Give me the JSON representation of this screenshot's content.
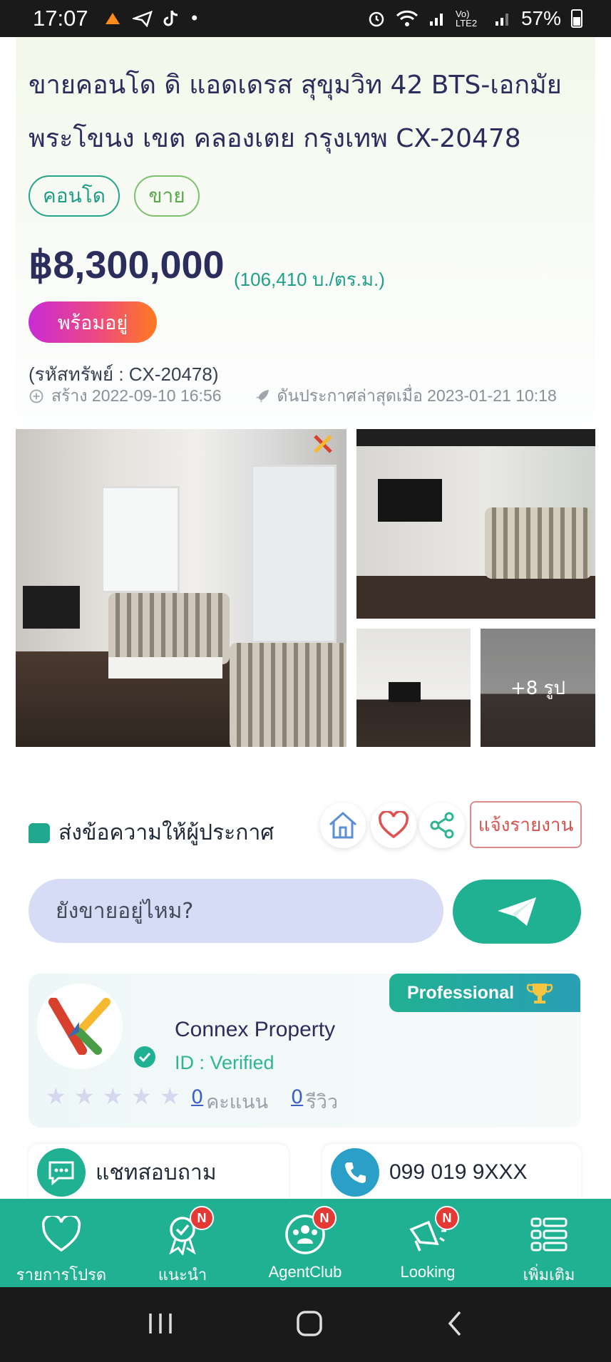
{
  "status_bar": {
    "time": "17:07",
    "battery": "57%",
    "network": "Vo) LTE2"
  },
  "listing": {
    "title": "ขายคอนโด ดิ แอดเดรส สุขุมวิท 42 BTS-เอกมัย พระโขนง เขต คลองเตย กรุงเทพ CX-20478",
    "tags": [
      "คอนโด",
      "ขาย"
    ],
    "price": "฿8,300,000",
    "price_per_sqm": "(106,410 บ./ตร.ม.)",
    "status_badge": "พร้อมอยู่",
    "asset_code": "(รหัสทรัพย์ : CX-20478)",
    "created": "สร้าง 2022-09-10 16:56",
    "bumped": "ดันประกาศล่าสุดเมื่อ 2023-01-21 10:18",
    "more_photos": "+8 รูป"
  },
  "actions": {
    "message_title": "ส่งข้อความให้ผู้ประกาศ",
    "report_label": "แจ้งรายงาน",
    "message_placeholder": "ยังขายอยู่ไหม?"
  },
  "agent": {
    "badge": "Professional",
    "name": "Connex Property",
    "id_label": "ID : Verified",
    "rating_stars": 0,
    "score_count": "0",
    "score_label": "คะแนน",
    "review_count": "0",
    "review_label": "รีวิว"
  },
  "contact": {
    "chat_label": "แชทสอบถาม",
    "phone": "099 019 9XXX"
  },
  "bottom_nav": {
    "items": [
      {
        "label": "รายการโปรด",
        "icon": "heart-icon",
        "badge": ""
      },
      {
        "label": "แนะนำ",
        "icon": "award-icon",
        "badge": "N"
      },
      {
        "label": "AgentClub",
        "icon": "group-icon",
        "badge": "N"
      },
      {
        "label": "Looking",
        "icon": "megaphone-icon",
        "badge": "N"
      },
      {
        "label": "เพิ่มเติม",
        "icon": "list-icon",
        "badge": ""
      }
    ]
  },
  "colors": {
    "accent": "#20b092",
    "title": "#2b2d5c",
    "report": "#d9534f",
    "input_bg": "#d6dcf5"
  }
}
